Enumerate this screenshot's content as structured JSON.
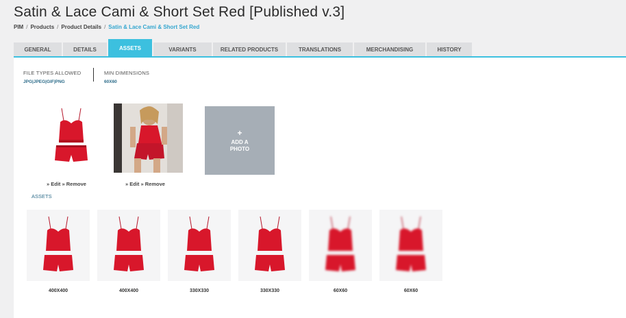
{
  "page": {
    "title": "Satin & Lace Cami & Short Set Red [Published v.3]",
    "breadcrumb": [
      "PIM",
      "Products",
      "Product Details",
      "Satin & Lace Cami & Short Set Red"
    ],
    "breadcrumb_separator": "/"
  },
  "tabs": [
    {
      "label": "GENERAL",
      "active": false
    },
    {
      "label": "DETAILS",
      "active": false
    },
    {
      "label": "ASSETS",
      "active": true
    },
    {
      "label": "VARIANTS",
      "active": false
    },
    {
      "label": "RELATED PRODUCTS",
      "active": false
    },
    {
      "label": "TRANSLATIONS",
      "active": false
    },
    {
      "label": "MERCHANDISING",
      "active": false
    },
    {
      "label": "HISTORY",
      "active": false
    }
  ],
  "file_types": {
    "label": "FILE TYPES ALLOWED",
    "value": "JPG|JPEG|GIF|PNG"
  },
  "min_dimensions": {
    "label": "MIN DIMENSIONS",
    "value": "60X60"
  },
  "photos": [
    {
      "kind": "product",
      "edit": "» Edit",
      "remove": "» Remove"
    },
    {
      "kind": "model",
      "edit": "» Edit",
      "remove": "» Remove"
    }
  ],
  "add_photo": {
    "icon": "plus-icon",
    "line1": "ADD A",
    "line2": "PHOTO"
  },
  "assets_label": "ASSETS",
  "assets": [
    {
      "size": "400X400",
      "blurred": false
    },
    {
      "size": "400X400",
      "blurred": false
    },
    {
      "size": "330X330",
      "blurred": false
    },
    {
      "size": "330X330",
      "blurred": false
    },
    {
      "size": "60X60",
      "blurred": true
    },
    {
      "size": "60X60",
      "blurred": true
    }
  ],
  "colors": {
    "accent": "#3cc0df",
    "link": "#34a6cf",
    "product_red": "#d8172b",
    "add_photo_bg": "#a6aeb6"
  }
}
